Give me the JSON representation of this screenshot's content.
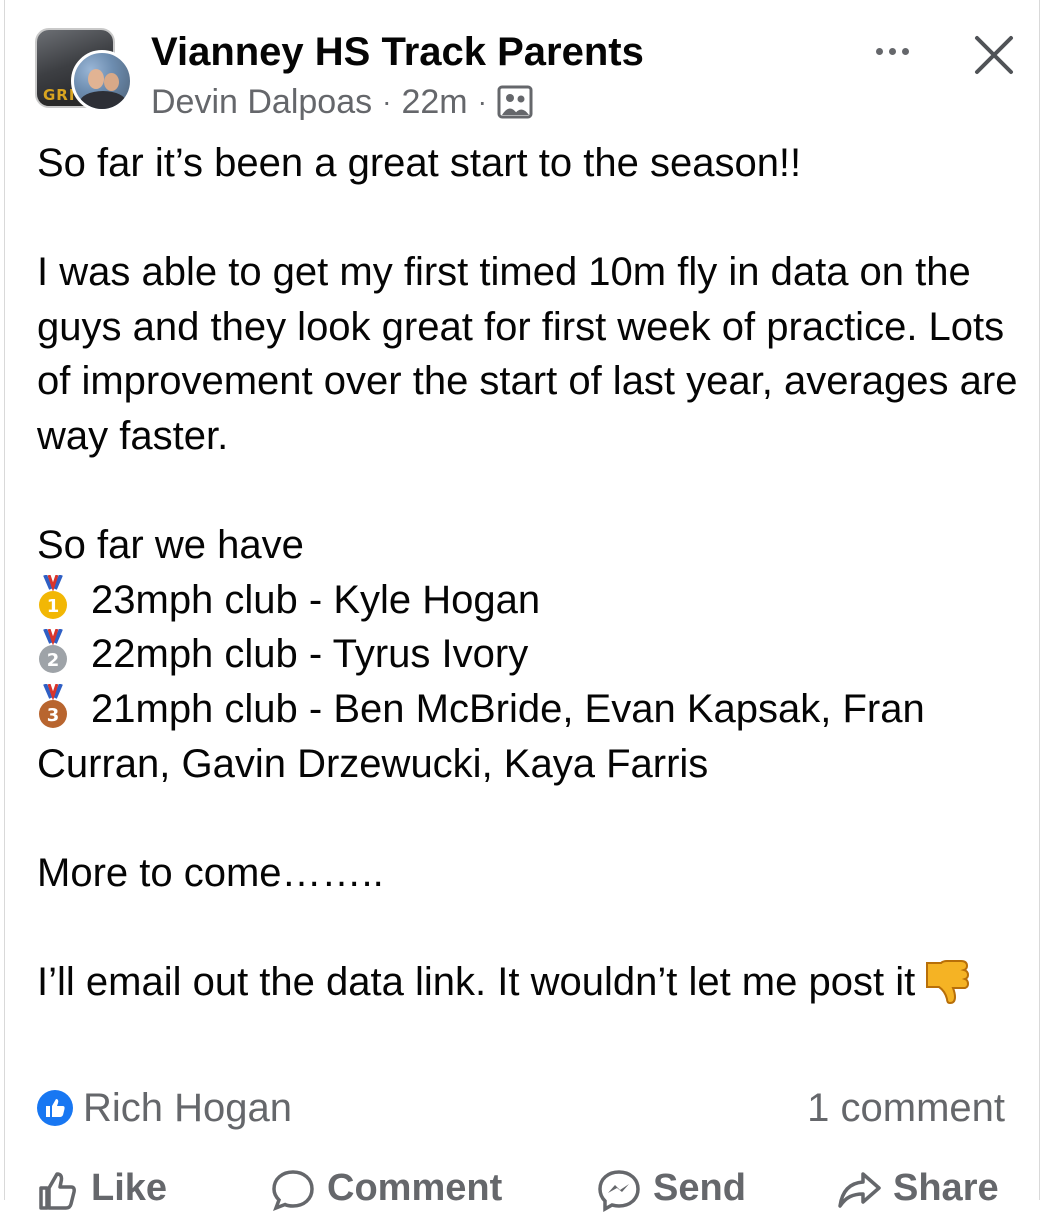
{
  "header": {
    "group_name": "Vianney HS Track Parents",
    "author": "Devin Dalpoas",
    "separator": "·",
    "time": "22m",
    "audience_icon": "group-audience-icon",
    "group_avatar_text": "GRI"
  },
  "post": {
    "line1": "So far it’s been a great start to the season!!",
    "para2": "I was able to get my first timed 10m fly in data on the guys and they look great for first week of practice. Lots of improvement over the start of last year, averages are way faster.",
    "so_far": "So far we have",
    "clubs": [
      {
        "medal": "gold",
        "medal_number": "1",
        "text": "23mph club - Kyle Hogan"
      },
      {
        "medal": "silver",
        "medal_number": "2",
        "text": "22mph club - Tyrus Ivory"
      },
      {
        "medal": "bronze",
        "medal_number": "3",
        "text": "21mph club - Ben McBride, Evan Kapsak, Fran Curran, Gavin Drzewucki, Kaya Farris"
      }
    ],
    "more": "More to come……..",
    "email_line": "I’ll email out the data link. It wouldn’t let me post it"
  },
  "reactions": {
    "reactor": "Rich Hogan",
    "comments": "1 comment"
  },
  "actions": {
    "like": "Like",
    "comment": "Comment",
    "send": "Send",
    "share": "Share"
  },
  "colors": {
    "text": "#050505",
    "secondary": "#65676b",
    "like_blue": "#1877f2",
    "gold": "#f2b705",
    "silver": "#9ea3a8",
    "bronze": "#b8652f"
  }
}
